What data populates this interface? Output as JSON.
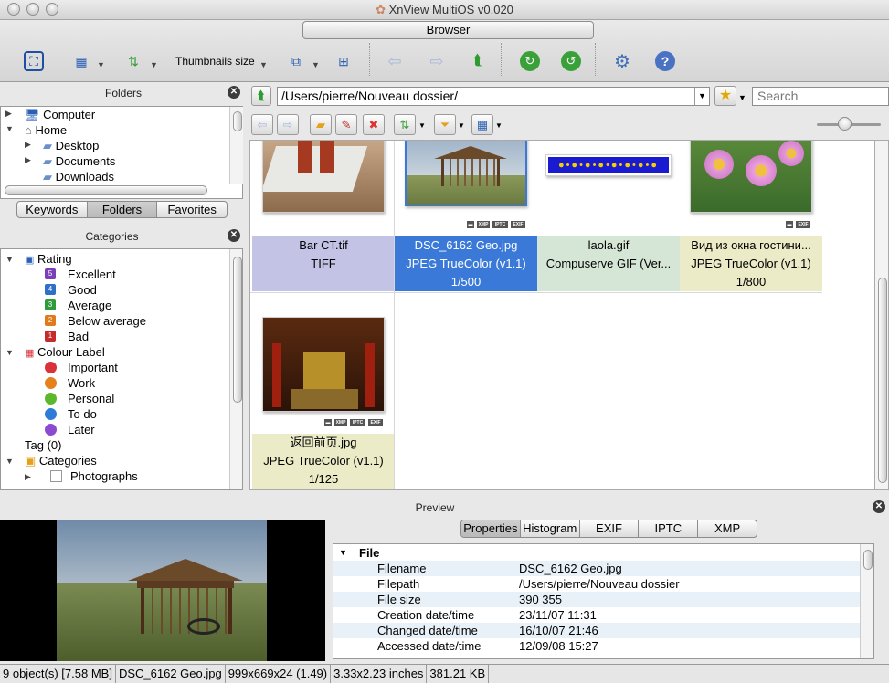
{
  "window": {
    "title": "XnView MultiOS v0.020"
  },
  "toolbar": {
    "browser_tab": "Browser",
    "thumbnails_size_label": "Thumbnails size"
  },
  "folders_panel": {
    "title": "Folders",
    "items": [
      {
        "label": "Computer",
        "icon": "computer-icon"
      },
      {
        "label": "Home",
        "icon": "home-icon"
      },
      {
        "label": "Desktop",
        "icon": "folder-icon"
      },
      {
        "label": "Documents",
        "icon": "folder-icon"
      },
      {
        "label": "Downloads",
        "icon": "folder-icon"
      }
    ],
    "tabs": [
      "Keywords",
      "Folders",
      "Favorites"
    ],
    "selected_tab": "Folders"
  },
  "categories_panel": {
    "title": "Categories",
    "rating_label": "Rating",
    "ratings": [
      {
        "label": "Excellent",
        "num": "5",
        "color": "#7b3fb8"
      },
      {
        "label": "Good",
        "num": "4",
        "color": "#2d6fc9"
      },
      {
        "label": "Average",
        "num": "3",
        "color": "#2f9a3a"
      },
      {
        "label": "Below average",
        "num": "2",
        "color": "#e07a1a"
      },
      {
        "label": "Bad",
        "num": "1",
        "color": "#c52b2b"
      }
    ],
    "colour_label": "Colour Label",
    "colours": [
      {
        "label": "Important",
        "color": "#d9333a"
      },
      {
        "label": "Work",
        "color": "#e5801d"
      },
      {
        "label": "Personal",
        "color": "#5cb82b"
      },
      {
        "label": "To do",
        "color": "#2f7bd8"
      },
      {
        "label": "Later",
        "color": "#8a4bd1"
      }
    ],
    "tag_label": "Tag (0)",
    "categories_label": "Categories",
    "sub_items": [
      "Photographs"
    ]
  },
  "browser": {
    "path": "/Users/pierre/Nouveau dossier/",
    "search_placeholder": "Search",
    "files": [
      {
        "name": "Bar CT.tif",
        "format": "TIFF",
        "extra": "",
        "selected": false,
        "bg": "#c3c3e6"
      },
      {
        "name": "DSC_6162 Geo.jpg",
        "format": "JPEG TrueColor (v1.1)",
        "extra": "1/500",
        "selected": true,
        "bg": "#3a79d8"
      },
      {
        "name": "laola.gif",
        "format": "Compuserve GIF (Ver...",
        "extra": "",
        "selected": false,
        "bg": "#d6e6d6"
      },
      {
        "name": "Вид из окна гостини...",
        "format": "JPEG TrueColor (v1.1)",
        "extra": "1/800",
        "selected": false,
        "bg": "#ebebc8"
      },
      {
        "name": "返回前页.jpg",
        "format": "JPEG TrueColor (v1.1)",
        "extra": "1/125",
        "selected": false,
        "bg": "#ebebc8"
      }
    ]
  },
  "preview": {
    "title": "Preview",
    "tabs": [
      "Properties",
      "Histogram",
      "EXIF",
      "IPTC",
      "XMP"
    ],
    "selected_tab": "Properties",
    "section": "File",
    "properties": [
      {
        "key": "Filename",
        "value": "DSC_6162 Geo.jpg"
      },
      {
        "key": "Filepath",
        "value": "/Users/pierre/Nouveau dossier"
      },
      {
        "key": "File size",
        "value": "390 355"
      },
      {
        "key": "Creation date/time",
        "value": "23/11/07 11:31"
      },
      {
        "key": "Changed date/time",
        "value": "16/10/07 21:46"
      },
      {
        "key": "Accessed date/time",
        "value": "12/09/08 15:27"
      }
    ]
  },
  "status": [
    "9 object(s) [7.58 MB]",
    "DSC_6162 Geo.jpg",
    "999x669x24 (1.49)",
    "3.33x2.23 inches",
    "381.21 KB"
  ]
}
